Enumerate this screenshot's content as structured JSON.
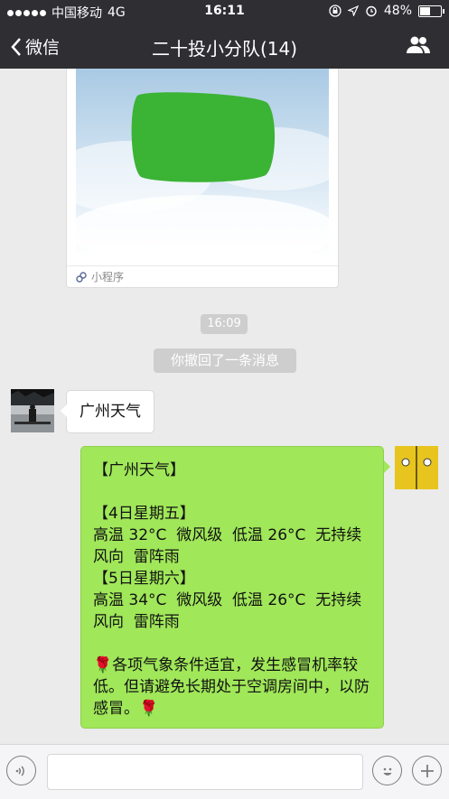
{
  "status_bar": {
    "carrier": "中国移动",
    "network": "4G",
    "time": "16:11",
    "battery": "48%",
    "battery_level": 0.48
  },
  "nav": {
    "back_label": "微信",
    "title": "二十投小分队(14)"
  },
  "messages": {
    "mini_program_label": "小程序",
    "time_divider": "16:09",
    "system_notice": "你撤回了一条消息",
    "incoming_text": "广州天气",
    "outgoing_text": "【广州天气】\n\n【4日星期五】\n高温 32°C  微风级  低温 26°C  无持续风向  雷阵雨\n【5日星期六】\n高温 34°C  微风级  低温 26°C  无持续风向  雷阵雨\n\n🌹各项气象条件适宜，发生感冒机率较低。但请避免长期处于空调房间中，以防感冒。🌹"
  },
  "input": {
    "value": "",
    "placeholder": ""
  },
  "colors": {
    "bar": "#2e2e33",
    "chat_bg": "#ebebeb",
    "bubble_green": "#a0e759",
    "redacted_green": "#3bb334"
  }
}
